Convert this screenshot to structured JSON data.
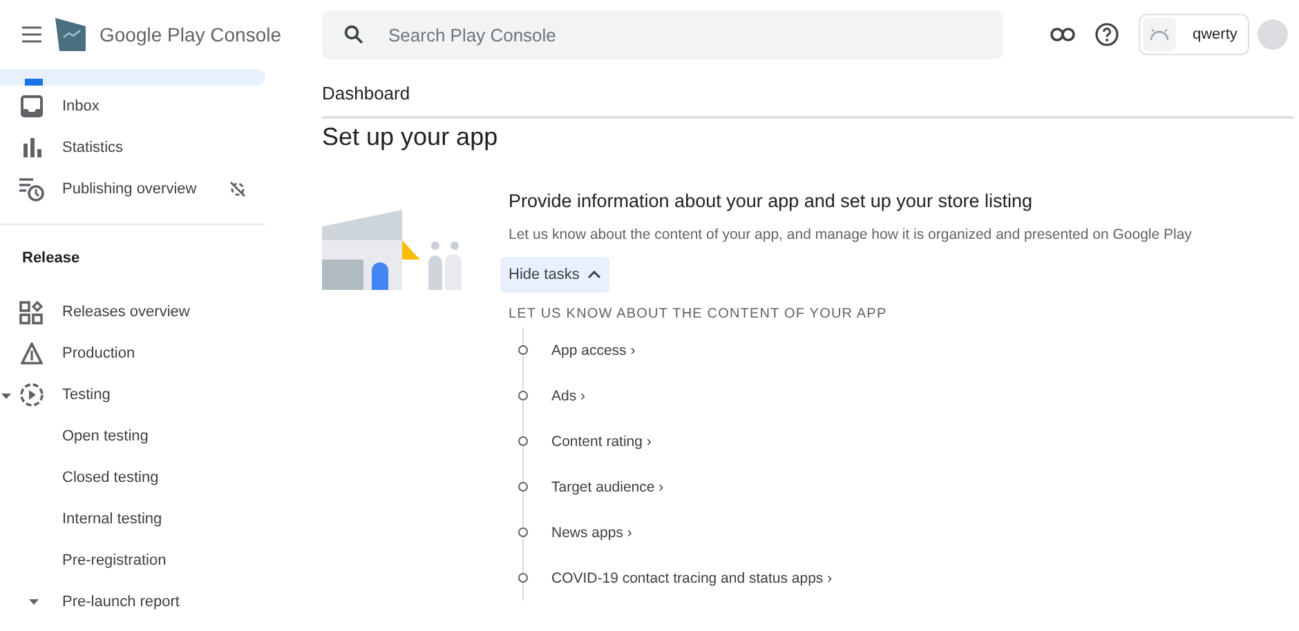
{
  "header": {
    "brand": "Google Play Console",
    "search": {
      "placeholder": "Search Play Console"
    },
    "account": "qwerty"
  },
  "sidebar": {
    "items": [
      {
        "kind": "selected-cut"
      },
      {
        "kind": "item",
        "label": "Inbox"
      },
      {
        "kind": "item",
        "label": "Statistics"
      },
      {
        "kind": "item",
        "label": "Publishing overview"
      },
      {
        "kind": "heading",
        "label": "Release"
      },
      {
        "kind": "item",
        "label": "Releases overview"
      },
      {
        "kind": "item",
        "label": "Production"
      },
      {
        "kind": "item",
        "label": "Testing",
        "expanded": true
      },
      {
        "kind": "sub",
        "label": "Open testing"
      },
      {
        "kind": "sub",
        "label": "Closed testing"
      },
      {
        "kind": "sub",
        "label": "Internal testing"
      },
      {
        "kind": "sub",
        "label": "Pre-registration"
      },
      {
        "kind": "sub",
        "label": "Pre-launch report",
        "expanded": true
      }
    ]
  },
  "main": {
    "breadcrumb": "Dashboard",
    "title": "Set up your app",
    "card": {
      "title": "Provide information about your app and set up your store listing",
      "description": "Let us know about the content of your app, and manage how it is organized and presented on Google Play",
      "toggle": "Hide tasks",
      "section": "LET US KNOW ABOUT THE CONTENT OF YOUR APP",
      "tasks": [
        {
          "label": "App access ›"
        },
        {
          "label": "Ads ›"
        },
        {
          "label": "Content rating ›"
        },
        {
          "label": "Target audience ›"
        },
        {
          "label": "News apps ›"
        },
        {
          "label": "COVID-19 contact tracing and status apps ›"
        }
      ]
    }
  }
}
